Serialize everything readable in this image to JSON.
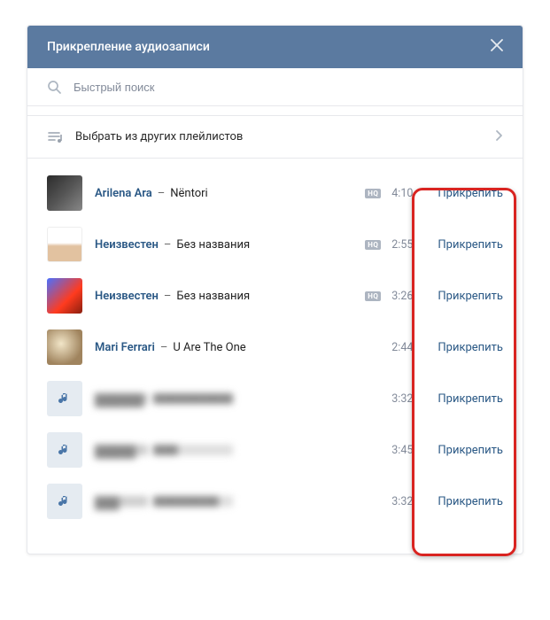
{
  "header": {
    "title": "Прикрепление аудиозаписи"
  },
  "search": {
    "placeholder": "Быстрый поиск"
  },
  "playlistSelector": {
    "label": "Выбрать из других плейлистов"
  },
  "attachLabel": "Прикрепить",
  "hqLabel": "HQ",
  "tracks": [
    {
      "artist": "Arilena Ara",
      "title": "Nëntori",
      "duration": "4:10",
      "hq": true,
      "coverClass": "cover-dark",
      "blurred": false
    },
    {
      "artist": "Неизвестен",
      "title": "Без названия",
      "duration": "2:55",
      "hq": true,
      "coverClass": "cover-light",
      "blurred": false
    },
    {
      "artist": "Неизвестен",
      "title": "Без названия",
      "duration": "3:26",
      "hq": true,
      "coverClass": "cover-red",
      "blurred": false
    },
    {
      "artist": "Mari Ferrari",
      "title": "U Are The One",
      "duration": "2:44",
      "hq": false,
      "coverClass": "cover-anim",
      "blurred": false
    },
    {
      "artist": "██████",
      "title": "████████████",
      "duration": "3:32",
      "hq": false,
      "coverClass": "cover-note",
      "blurred": true
    },
    {
      "artist": "█████",
      "title": "███",
      "duration": "3:45",
      "hq": false,
      "coverClass": "cover-note",
      "blurred": true
    },
    {
      "artist": "███",
      "title": "████████",
      "duration": "3:32",
      "hq": false,
      "coverClass": "cover-note",
      "blurred": true
    }
  ]
}
